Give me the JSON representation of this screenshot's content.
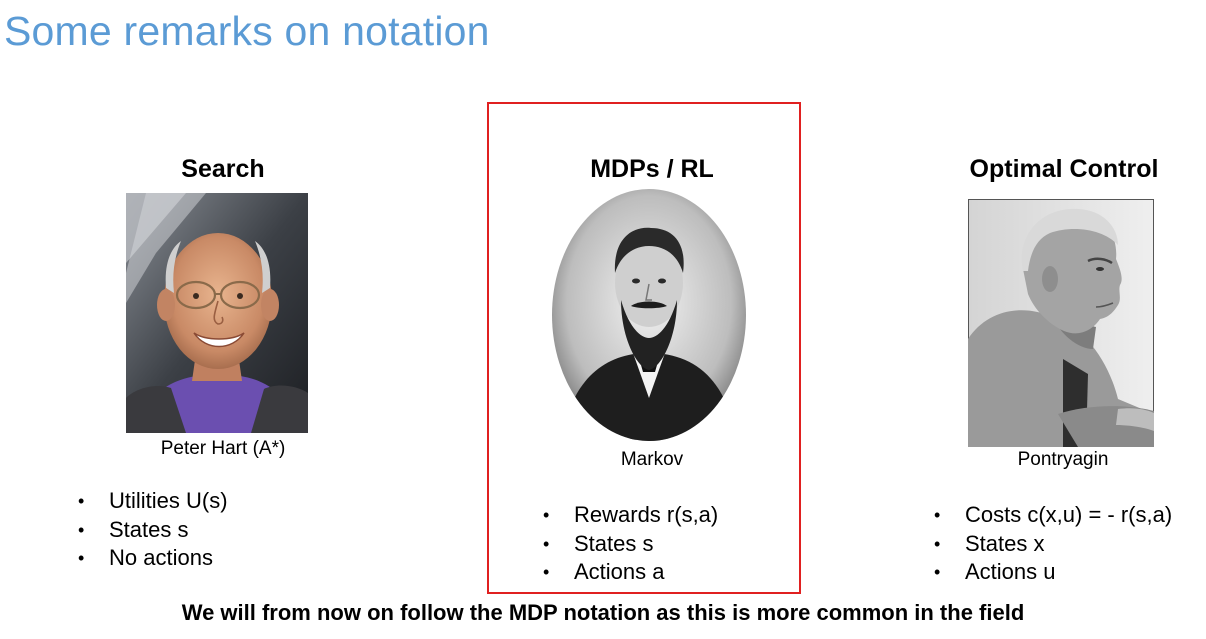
{
  "slide": {
    "title": "Some remarks on notation",
    "footer": "We will from now on follow the MDP notation as this is more common in the field"
  },
  "columns": [
    {
      "heading": "Search",
      "portrait_caption": "Peter Hart (A*)",
      "bullets": [
        "Utilities U(s)",
        "States s",
        "No actions"
      ]
    },
    {
      "heading": "MDPs / RL",
      "portrait_caption": "Markov",
      "bullets": [
        "Rewards r(s,a)",
        "States s",
        "Actions a"
      ],
      "highlighted": true
    },
    {
      "heading": "Optimal Control",
      "portrait_caption": "Pontryagin",
      "bullets": [
        "Costs c(x,u) = - r(s,a)",
        "States x",
        "Actions u"
      ]
    }
  ],
  "colors": {
    "title": "#5b9bd5",
    "highlight_border": "#e02020"
  }
}
